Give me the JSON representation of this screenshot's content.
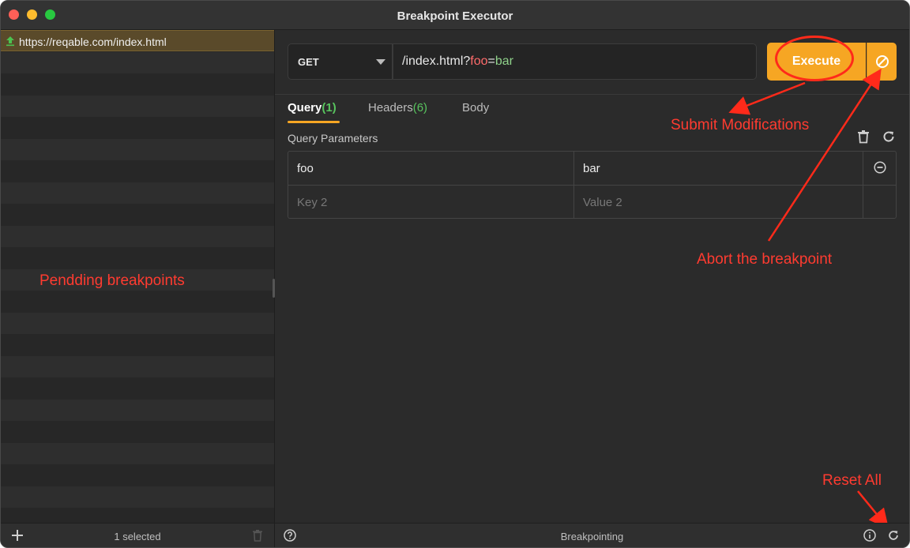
{
  "window": {
    "title": "Breakpoint Executor"
  },
  "pending_list": {
    "items": [
      {
        "direction_icon": "upload-arrow-icon",
        "url": "https://reqable.com/index.html"
      }
    ],
    "annotation": "Pendding breakpoints",
    "footer": {
      "selection": "1 selected"
    }
  },
  "request": {
    "method": "GET",
    "url_path": "/index.html?",
    "url_query_key": "foo",
    "url_query_eq": "=",
    "url_query_value": "bar"
  },
  "actions": {
    "execute_label": "Execute",
    "abort_icon": "abort-circle-slash-icon"
  },
  "tabs": [
    {
      "label": "Query",
      "count": "(1)",
      "active": true
    },
    {
      "label": "Headers",
      "count": "(6)",
      "active": false
    },
    {
      "label": "Body",
      "count": "",
      "active": false
    }
  ],
  "query_params": {
    "section_label": "Query Parameters",
    "rows": [
      {
        "key": "foo",
        "value": "bar"
      }
    ],
    "placeholder_row": {
      "key": "Key 2",
      "value": "Value 2"
    }
  },
  "annotations": {
    "submit": "Submit Modifications",
    "abort": "Abort the breakpoint",
    "reset": "Reset All"
  },
  "status_bar": {
    "status": "Breakpointing"
  },
  "colors": {
    "accent": "#f6a623",
    "annotation": "#ff3b30",
    "count_green": "#58c45e",
    "query_key": "#ff6b6b",
    "query_value": "#8fd18a"
  }
}
